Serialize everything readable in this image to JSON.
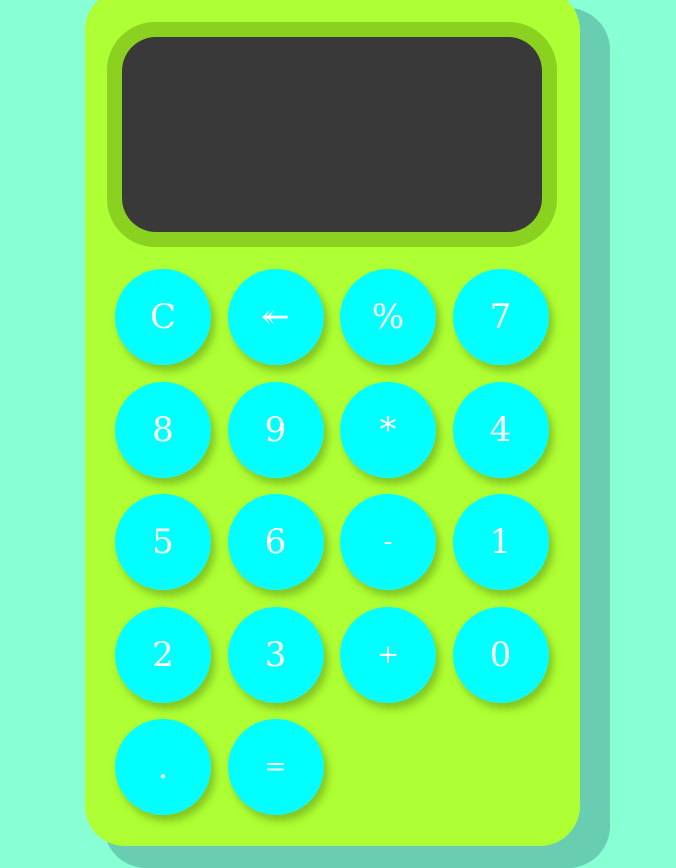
{
  "display": {
    "value": ""
  },
  "keys": [
    "C",
    "↞",
    "%",
    "7",
    "8",
    "9",
    "*",
    "4",
    "5",
    "6",
    "-",
    "1",
    "2",
    "3",
    "+",
    "0",
    ".",
    "="
  ],
  "colors": {
    "background": "#88ffd5",
    "calculator_body": "#aeff33",
    "screen_frame": "#8ad21f",
    "screen": "#393939",
    "key": "#00ffff",
    "key_text": "#ffffff"
  }
}
